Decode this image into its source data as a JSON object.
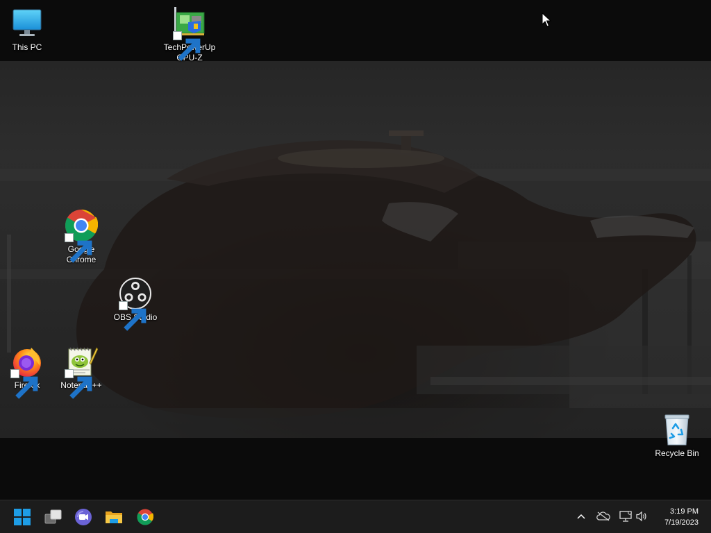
{
  "desktop": {
    "icons": {
      "this_pc": "This PC",
      "gpu_z": "TechPowerUp GPU-Z",
      "chrome": "Google Chrome",
      "obs": "OBS Studio",
      "firefox": "Firefox",
      "notepadpp": "Notepad++",
      "recycle_bin": "Recycle Bin"
    }
  },
  "taskbar": {
    "pinned": [
      "start-icon",
      "task-view-icon",
      "teams-chat-icon",
      "file-explorer-icon",
      "chrome-icon"
    ],
    "tray": [
      "show-hidden-icons-chevron-icon",
      "onedrive-offline-icon",
      "network-icon",
      "volume-icon"
    ],
    "clock": {
      "time": "3:19 PM",
      "date": "7/19/2023"
    }
  },
  "colors": {
    "taskbar_bg": "#1c1c1c",
    "windows_blue": "#1e9de6",
    "chrome_red": "#db4437",
    "chrome_yellow": "#f4b400",
    "chrome_green": "#0f9d58",
    "chrome_blue": "#4285f4"
  }
}
